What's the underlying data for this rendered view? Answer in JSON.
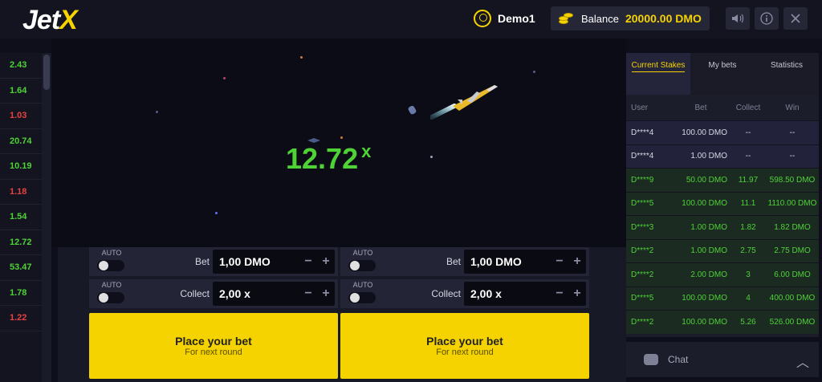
{
  "header": {
    "logo_main": "Jet",
    "logo_accent": "X",
    "username": "Demo1",
    "balance_label": "Balance",
    "balance_value": "20000.00 DMO",
    "icons": [
      "sound-icon",
      "info-icon",
      "close-icon"
    ]
  },
  "history": [
    {
      "value": "2.43",
      "color": "#4ed236"
    },
    {
      "value": "1.64",
      "color": "#4ed236"
    },
    {
      "value": "1.03",
      "color": "#e84141"
    },
    {
      "value": "20.74",
      "color": "#4ed236"
    },
    {
      "value": "10.19",
      "color": "#4ed236"
    },
    {
      "value": "1.18",
      "color": "#e84141"
    },
    {
      "value": "1.54",
      "color": "#4ed236"
    },
    {
      "value": "12.72",
      "color": "#4ed236"
    },
    {
      "value": "53.47",
      "color": "#4ed236"
    },
    {
      "value": "1.78",
      "color": "#4ed236"
    },
    {
      "value": "1.22",
      "color": "#e84141"
    }
  ],
  "game": {
    "multiplier": "12.72",
    "multiplier_suffix": "x"
  },
  "panels": [
    {
      "auto_bet_label": "AUTO",
      "bet_label": "Bet",
      "bet_value": "1,00 DMO",
      "auto_collect_label": "AUTO",
      "collect_label": "Collect",
      "collect_value": "2,00 x",
      "button_main": "Place your bet",
      "button_sub": "For next round"
    },
    {
      "auto_bet_label": "AUTO",
      "bet_label": "Bet",
      "bet_value": "1,00 DMO",
      "auto_collect_label": "AUTO",
      "collect_label": "Collect",
      "collect_value": "2,00 x",
      "button_main": "Place your bet",
      "button_sub": "For next round"
    }
  ],
  "stakes": {
    "tabs": [
      {
        "label": "Current Stakes",
        "active": true
      },
      {
        "label": "My bets",
        "active": false
      },
      {
        "label": "Statistics",
        "active": false
      }
    ],
    "columns": [
      "User",
      "Bet",
      "Collect",
      "Win"
    ],
    "rows": [
      {
        "user": "D****4",
        "bet": "100.00  DMO",
        "collect": "--",
        "win": "--",
        "state": "neutral"
      },
      {
        "user": "D****4",
        "bet": "1.00  DMO",
        "collect": "--",
        "win": "--",
        "state": "neutral"
      },
      {
        "user": "D****9",
        "bet": "50.00  DMO",
        "collect": "11.97",
        "win": "598.50  DMO",
        "state": "win"
      },
      {
        "user": "D****5",
        "bet": "100.00  DMO",
        "collect": "11.1",
        "win": "1110.00  DMO",
        "state": "win"
      },
      {
        "user": "D****3",
        "bet": "1.00  DMO",
        "collect": "1.82",
        "win": "1.82  DMO",
        "state": "win"
      },
      {
        "user": "D****2",
        "bet": "1.00  DMO",
        "collect": "2.75",
        "win": "2.75  DMO",
        "state": "win"
      },
      {
        "user": "D****2",
        "bet": "2.00  DMO",
        "collect": "3",
        "win": "6.00  DMO",
        "state": "win"
      },
      {
        "user": "D****5",
        "bet": "100.00  DMO",
        "collect": "4",
        "win": "400.00  DMO",
        "state": "win"
      },
      {
        "user": "D****2",
        "bet": "100.00  DMO",
        "collect": "5.26",
        "win": "526.00  DMO",
        "state": "win"
      }
    ]
  },
  "chat": {
    "label": "Chat"
  },
  "colors": {
    "accent": "#f5d300",
    "win": "#4ed236",
    "loss": "#e84141"
  }
}
